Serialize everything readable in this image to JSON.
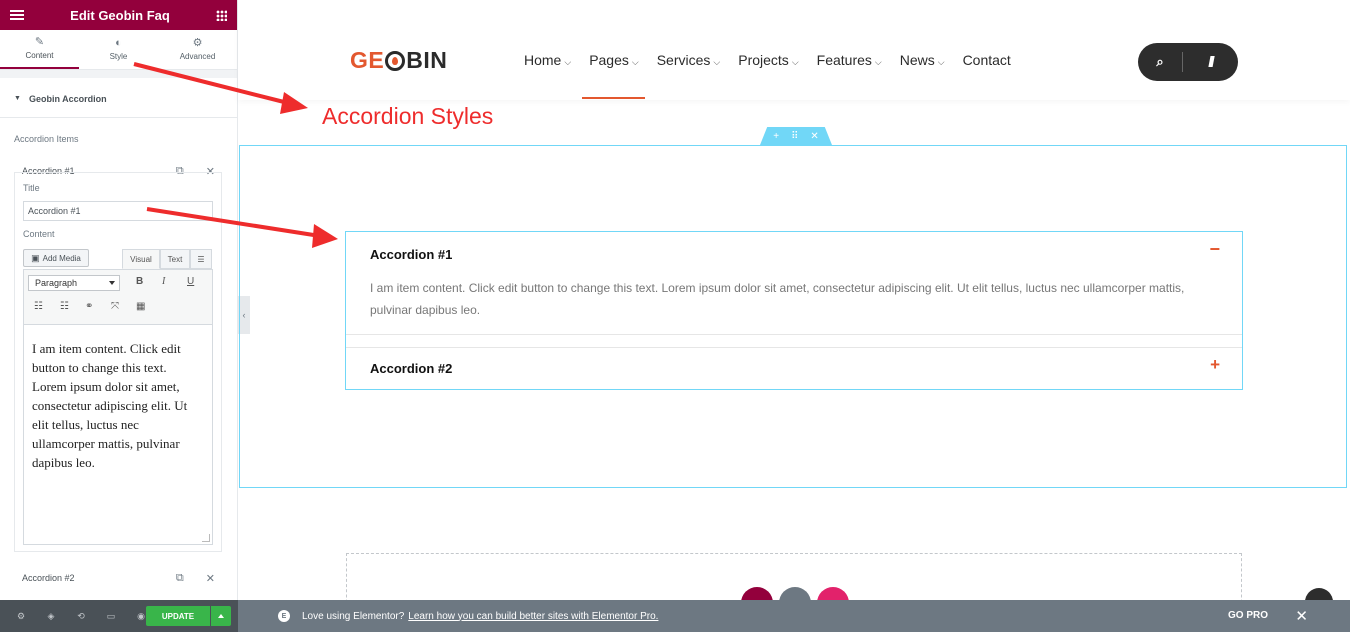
{
  "sidebar": {
    "title": "Edit Geobin Faq",
    "tabs": [
      {
        "label": "Content",
        "icon": "pencil-icon"
      },
      {
        "label": "Style",
        "icon": "half-circle-icon"
      },
      {
        "label": "Advanced",
        "icon": "gear-icon"
      }
    ],
    "section_title": "Geobin Accordion",
    "items_label": "Accordion Items",
    "item1": {
      "label": "Accordion #1",
      "title_label": "Title",
      "title_value": "Accordion #1",
      "content_label": "Content",
      "add_media": "Add Media",
      "editor_tabs": [
        "Visual",
        "Text"
      ],
      "format_select": "Paragraph",
      "bold": "B",
      "italic": "I",
      "underline": "U",
      "editor_text": "I am item content. Click edit button to change this text. Lorem ipsum dolor sit amet, consectetur adipiscing elit. Ut elit tellus, luctus nec ullamcorper mattis, pulvinar dapibus leo."
    },
    "item2": {
      "label": "Accordion #2"
    },
    "footer": {
      "update": "UPDATE"
    }
  },
  "promo": {
    "text": "Love using Elementor?",
    "link": "Learn how you can build better sites with Elementor Pro.",
    "go_pro": "GO PRO",
    "close": "✕"
  },
  "site": {
    "logo_ge": "GE",
    "logo_bin": "BIN",
    "nav": [
      "Home",
      "Pages",
      "Services",
      "Projects",
      "Features",
      "News",
      "Contact"
    ],
    "active_nav": "Pages"
  },
  "annotation": "Accordion Styles",
  "accordion": {
    "items": [
      {
        "title": "Accordion #1",
        "content": "I am item content. Click edit button to change this text. Lorem ipsum dolor sit amet, consectetur adipiscing elit. Ut elit tellus, luctus nec ullamcorper mattis, pulvinar dapibus leo.",
        "open": true
      },
      {
        "title": "Accordion #2",
        "open": false
      }
    ]
  },
  "colors": {
    "brand": "#93003c",
    "accent": "#e3582f",
    "selection": "#71d7f7",
    "annotation": "#ee2c2c",
    "update": "#39b54a"
  }
}
